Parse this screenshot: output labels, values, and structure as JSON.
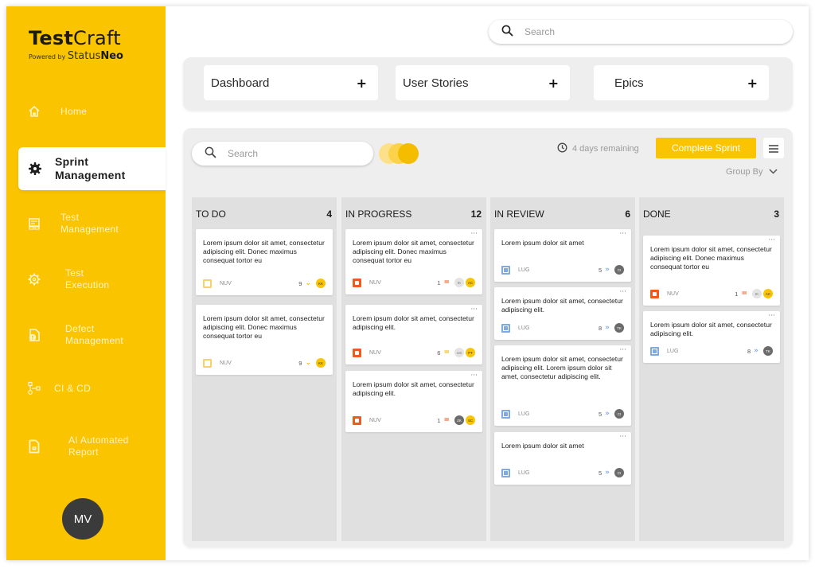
{
  "brand": {
    "name_bold": "Test",
    "name_light": "Craft",
    "powered_by": "Powered by",
    "partner_light": "Status",
    "partner_bold": "Neo",
    "color": "#fbc400"
  },
  "sidebar": {
    "items": [
      {
        "label": "Home",
        "icon": "home-icon"
      },
      {
        "label": "Sprint Management",
        "line1": "Sprint",
        "line2": "Management",
        "icon": "gear-icon",
        "active": true
      },
      {
        "label": "Test Management",
        "line1": "Test",
        "line2": "Management",
        "icon": "dashboard-icon"
      },
      {
        "label": "Test Execution",
        "line1": "Test",
        "line2": "Execution",
        "icon": "cog-refresh-icon"
      },
      {
        "label": "Defect Management",
        "line1": "Defect",
        "line2": "Management",
        "icon": "bug-document-icon"
      },
      {
        "label": "CI & CD",
        "icon": "pipeline-icon"
      },
      {
        "label": "AI Automated Report",
        "line1": "AI Automated",
        "line2": "Report",
        "icon": "report-icon"
      }
    ],
    "user_initials": "MV"
  },
  "top_search": {
    "placeholder": "Search"
  },
  "quick_tabs": [
    {
      "label": "Dashboard",
      "add": "+"
    },
    {
      "label": "User Stories",
      "add": "+"
    },
    {
      "label": "Epics",
      "add": "+"
    }
  ],
  "board": {
    "search_placeholder": "Search",
    "remaining": "4 days remaining",
    "complete_label": "Complete Sprint",
    "group_by": "Group By",
    "columns": [
      {
        "title": "TO DO",
        "count": "4",
        "cards": [
          {
            "text": "Lorem ipsum dolor sit amet, consectetur adipiscing elit. Donec maximus consequat tortor eu",
            "type": "story",
            "project": "NUV",
            "points": "9",
            "priority": "low",
            "priority_glyph": "⌄",
            "assignees": [
              "KK"
            ]
          },
          {
            "text": "Lorem ipsum dolor sit amet, consectetur adipiscing elit. Donec maximus consequat tortor eu",
            "type": "story",
            "project": "NUV",
            "points": "9",
            "priority": "low",
            "priority_glyph": "⌄",
            "assignees": [
              "KK"
            ]
          }
        ]
      },
      {
        "title": "IN PROGRESS",
        "count": "12",
        "cards": [
          {
            "text": "Lorem ipsum dolor sit amet, consectetur adipiscing elit. Donec maximus consequat tortor eu",
            "type": "bug",
            "project": "NUV",
            "points": "1",
            "priority": "med",
            "priority_glyph": "=",
            "assignees": [
              "IK",
              "AC"
            ]
          },
          {
            "text": "Lorem ipsum dolor sit amet, consectetur adipiscing elit.",
            "type": "bug",
            "project": "NUV",
            "points": "6",
            "priority": "low",
            "priority_glyph": "=",
            "assignees": [
              "US",
              "PT"
            ]
          },
          {
            "text": "Lorem ipsum dolor sit amet, consectetur adipiscing elit.",
            "type": "bug",
            "project": "NUV",
            "points": "1",
            "priority": "med",
            "priority_glyph": "=",
            "assignees": [
              "ZK",
              "SC"
            ]
          }
        ]
      },
      {
        "title": "IN REVIEW",
        "count": "6",
        "cards": [
          {
            "text": "Lorem ipsum dolor sit amet",
            "type": "task",
            "project": "LUG",
            "points": "5",
            "priority": "lowest",
            "priority_glyph": "»",
            "assignees": [
              "CI"
            ]
          },
          {
            "text": "Lorem ipsum dolor sit amet, consectetur adipiscing elit.",
            "type": "task",
            "project": "LUG",
            "points": "8",
            "priority": "lowest",
            "priority_glyph": "»",
            "assignees": [
              "TK"
            ]
          },
          {
            "text": "Lorem ipsum dolor sit amet, consectetur adipiscing elit. Lorem ipsum dolor sit amet, consectetur adipiscing elit.",
            "type": "task",
            "project": "LUG",
            "points": "5",
            "priority": "lowest",
            "priority_glyph": "»",
            "assignees": [
              "CI"
            ]
          },
          {
            "text": "Lorem ipsum dolor sit amet",
            "type": "task",
            "project": "LUG",
            "points": "5",
            "priority": "lowest",
            "priority_glyph": "»",
            "assignees": [
              "CI"
            ]
          }
        ]
      },
      {
        "title": "DONE",
        "count": "3",
        "cards": [
          {
            "text": "Lorem ipsum dolor sit amet, consectetur adipiscing elit. Donec maximus consequat tortor eu",
            "type": "bug",
            "project": "NUV",
            "points": "1",
            "priority": "med",
            "priority_glyph": "=",
            "assignees": [
              "IK",
              "AC"
            ]
          },
          {
            "text": "Lorem ipsum dolor sit amet, consectetur adipiscing elit.",
            "type": "task",
            "project": "LUG",
            "points": "8",
            "priority": "lowest",
            "priority_glyph": "»",
            "assignees": [
              "TK"
            ]
          }
        ]
      }
    ]
  }
}
